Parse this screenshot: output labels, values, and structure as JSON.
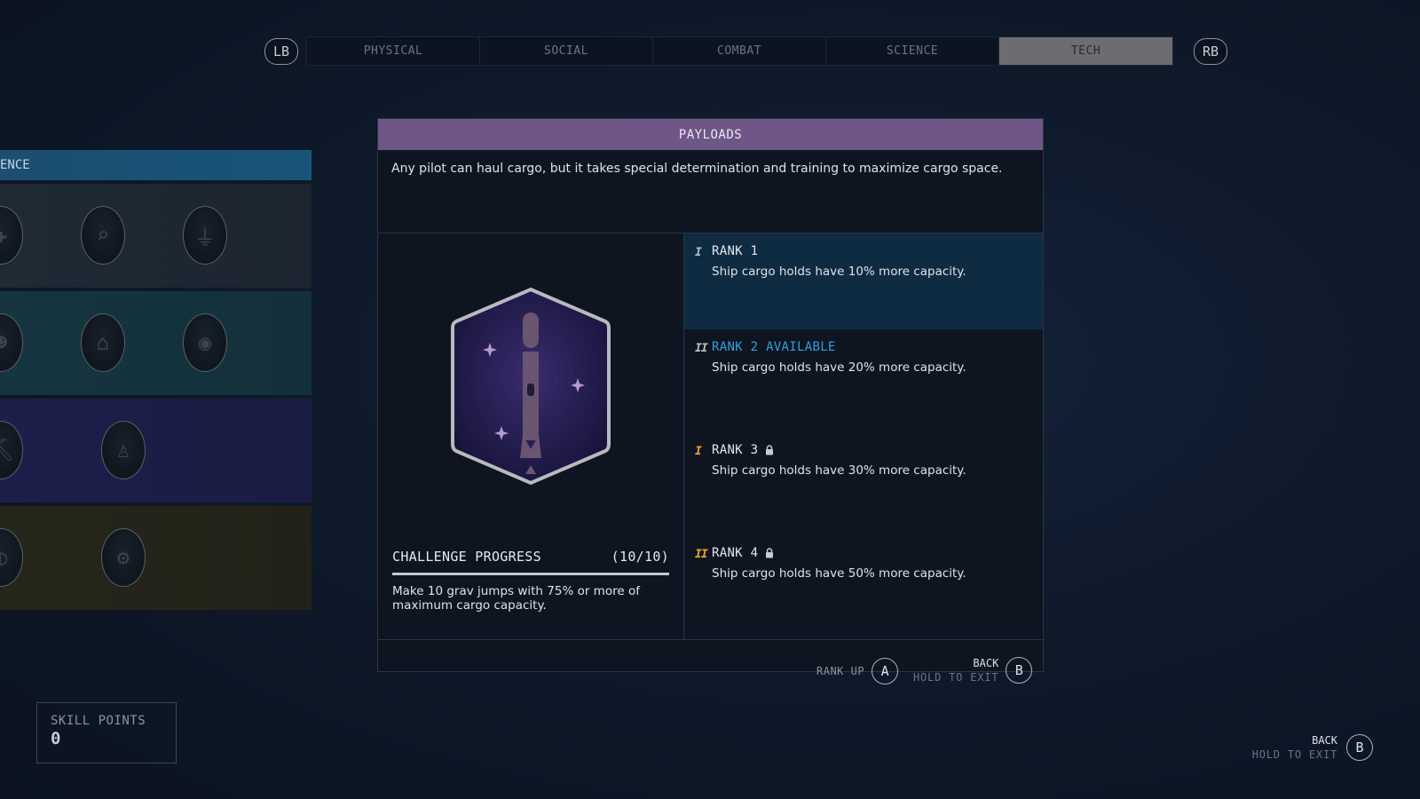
{
  "topbar": {
    "left_bumper": "LB",
    "right_bumper": "RB",
    "tabs": [
      {
        "label": "PHYSICAL",
        "active": false
      },
      {
        "label": "SOCIAL",
        "active": false
      },
      {
        "label": "COMBAT",
        "active": false
      },
      {
        "label": "SCIENCE",
        "active": false
      },
      {
        "label": "TECH",
        "active": true
      }
    ]
  },
  "skill_tree": {
    "header_label": "ENCE",
    "tiers": [
      {
        "name": "tier-1",
        "skills": [
          "medicine-icon",
          "research-icon",
          "scanning-icon",
          "hidden-icon"
        ]
      },
      {
        "name": "tier-2",
        "skills": [
          "astronaut-icon",
          "weapon-engineering-icon",
          "zoology-icon"
        ]
      },
      {
        "name": "tier-3",
        "skills": [
          "surveying-icon",
          "outpost-icon"
        ]
      },
      {
        "name": "tier-4",
        "skills": [
          "planetary-icon",
          "engineering-compass-icon"
        ]
      }
    ]
  },
  "panel": {
    "title": "PAYLOADS",
    "description": "Any pilot can haul cargo, but it takes special determination and training to maximize cargo space.",
    "patch_icon": "rocket-patch-icon",
    "challenge": {
      "label": "CHALLENGE PROGRESS",
      "progress_text": "(10/10)",
      "current": 10,
      "total": 10,
      "description": "Make 10 grav jumps with 75% or more of maximum cargo capacity."
    },
    "ranks": [
      {
        "title": "RANK 1",
        "desc": "Ship cargo holds have 10% more capacity.",
        "state": "current",
        "mark": "I",
        "mark_color": "#b9bec5",
        "locked": false
      },
      {
        "title": "RANK 2 AVAILABLE",
        "desc": "Ship cargo holds have 20% more capacity.",
        "state": "available",
        "mark": "II",
        "mark_color": "#b9bec5",
        "locked": false
      },
      {
        "title": "RANK 3",
        "desc": "Ship cargo holds have 30% more capacity.",
        "state": "locked",
        "mark": "I",
        "mark_color": "#e8a62a",
        "locked": true
      },
      {
        "title": "RANK 4",
        "desc": "Ship cargo holds have 50% more capacity.",
        "state": "locked",
        "mark": "II",
        "mark_color": "#e8a62a",
        "locked": true
      }
    ],
    "footer": {
      "rank_up_label": "RANK UP",
      "rank_up_button": "A",
      "back_label": "BACK",
      "hold_label": "HOLD TO EXIT",
      "back_button": "B"
    }
  },
  "skill_points": {
    "label": "SKILL POINTS",
    "value": "0"
  },
  "global_back": {
    "back_label": "BACK",
    "hold_label": "HOLD TO EXIT",
    "button": "B"
  },
  "colors": {
    "accent_purple": "#6e5687",
    "available_blue": "#2ba3e0",
    "locked_orange": "#e8a62a",
    "current_rank_bg": "#0f2b42"
  }
}
